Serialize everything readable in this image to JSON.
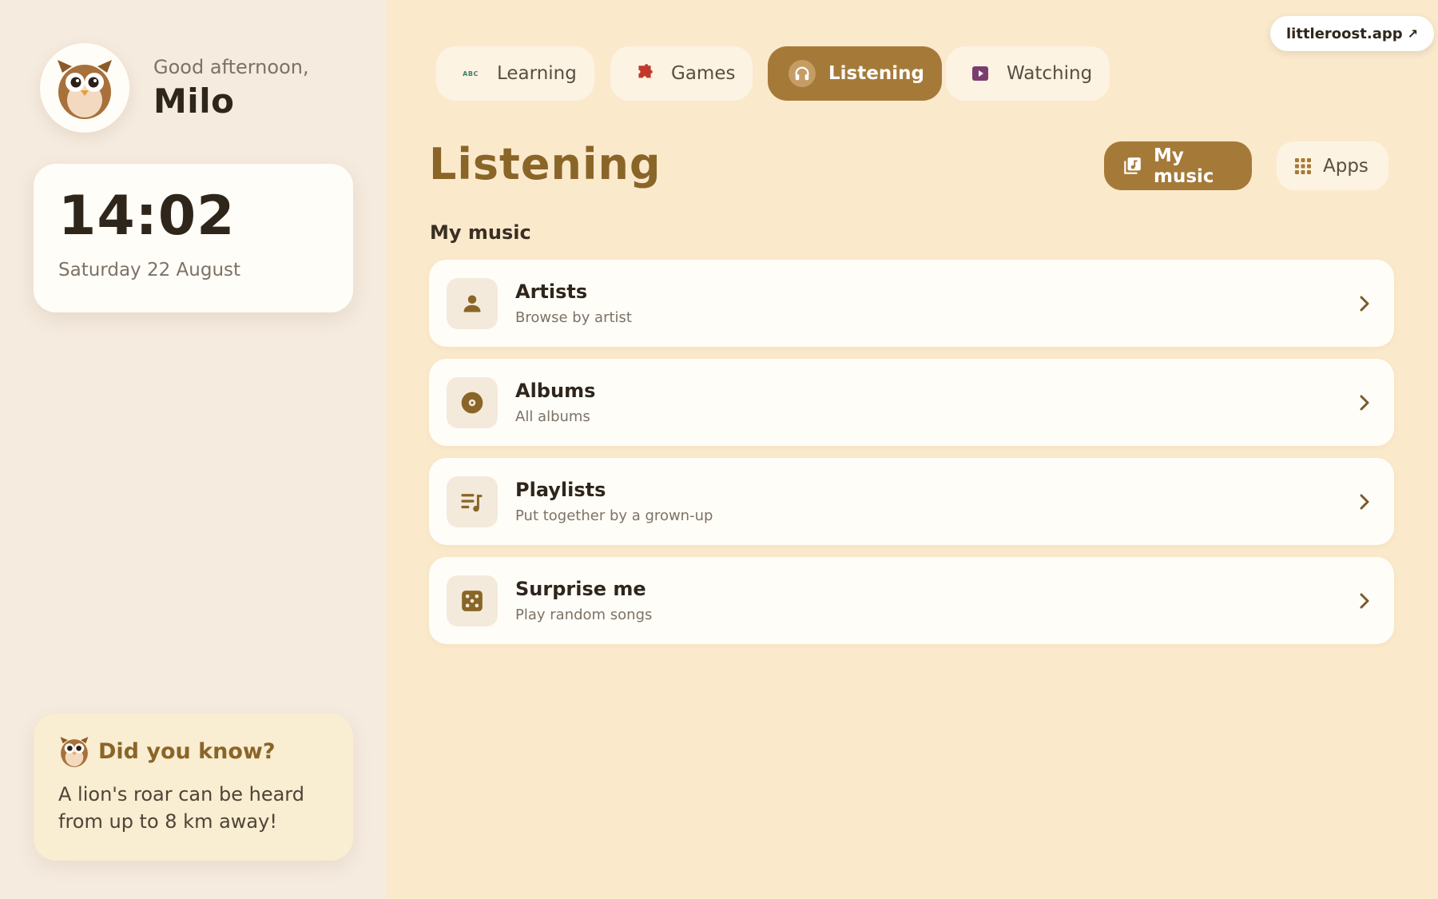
{
  "colors": {
    "accent": "#a57a38",
    "title": "#8a6528",
    "background": "#fbe9cc",
    "sidebar": "#f5ebdf",
    "card": "#fffdf8"
  },
  "sidebar": {
    "greeting": "Good afternoon,",
    "name": "Milo",
    "avatar_icon": "owl-avatar",
    "clock": {
      "time": "14:02",
      "date": "Saturday 22 August"
    },
    "tip": {
      "title": "Did you know?",
      "body": "A lion's roar can be heard from up to 8 km away!",
      "icon": "owl-icon"
    }
  },
  "nav": {
    "tabs": [
      {
        "label": "Learning",
        "icon": "abc-icon",
        "badge": "ABC",
        "active": false
      },
      {
        "label": "Games",
        "icon": "puzzle-icon",
        "active": false
      },
      {
        "label": "Listening",
        "icon": "headphones-icon",
        "active": true
      },
      {
        "label": "Watching",
        "icon": "play-icon",
        "active": false
      }
    ]
  },
  "site_link": {
    "label": "littleroost.app",
    "arrow": "↗"
  },
  "main": {
    "title": "Listening",
    "modes": [
      {
        "label": "My music",
        "icon": "music-library-icon",
        "active": true
      },
      {
        "label": "Apps",
        "icon": "grid-icon",
        "active": false
      }
    ],
    "section_label": "My music",
    "items": [
      {
        "title": "Artists",
        "subtitle": "Browse by artist",
        "icon": "person-icon"
      },
      {
        "title": "Albums",
        "subtitle": "All albums",
        "icon": "disc-icon"
      },
      {
        "title": "Playlists",
        "subtitle": "Put together by a grown-up",
        "icon": "playlist-icon"
      },
      {
        "title": "Surprise me",
        "subtitle": "Play random songs",
        "icon": "dice-icon"
      }
    ]
  }
}
